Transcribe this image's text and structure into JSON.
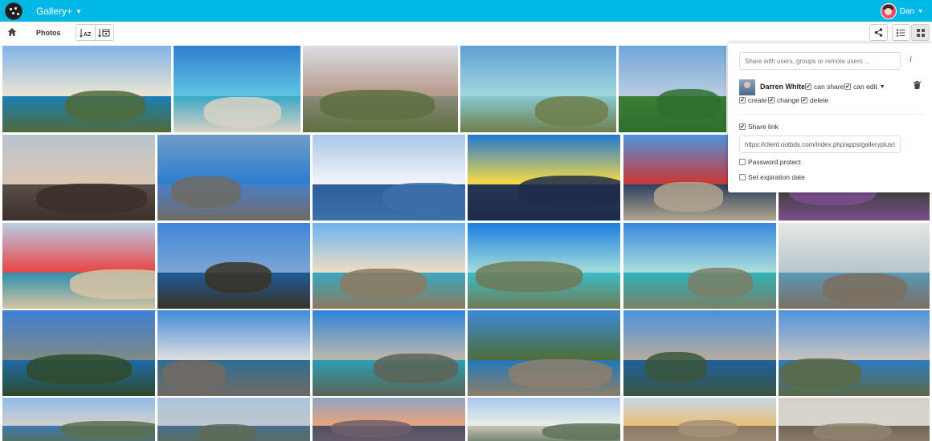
{
  "header": {
    "app_name": "Gallery+",
    "user_name": "Dan",
    "bg_color": "#00b8e6"
  },
  "toolbar": {
    "breadcrumb_label": "Photos",
    "sort_name_icon": "sort-alpha-icon",
    "sort_date_icon": "sort-date-icon",
    "share_icon": "share-icon",
    "list_view_icon": "list-view-icon",
    "grid_view_icon": "grid-view-icon"
  },
  "share_panel": {
    "search_placeholder": "Share with users, groups or remote users ...",
    "sharee": {
      "name": "Darren White",
      "can_share_label": "can share",
      "can_edit_label": "can edit",
      "create_label": "create",
      "change_label": "change",
      "delete_label": "delete",
      "can_share": true,
      "can_edit": true,
      "create": true,
      "change": true,
      "delete": true
    },
    "share_link_label": "Share link",
    "share_link_checked": true,
    "share_link_url": "https://client.ootbds.com/index.php/apps/galleryplus/s/",
    "password_protect_label": "Password protect",
    "password_protect_checked": false,
    "expiration_label": "Set expiration date",
    "expiration_checked": false
  },
  "gallery": {
    "photos": [
      {
        "sky": "#7fb3e8",
        "land": "#4f6b3a",
        "sea": "#1b7fb6",
        "accent": "#e9e3d6"
      },
      {
        "sky": "#2f7fd0",
        "land": "#d8d2c4",
        "sea": "#3aa8c6",
        "accent": "#5cc2e0"
      },
      {
        "sky": "#dcdde5",
        "land": "#5d6f3e",
        "sea": "#8a8a7a",
        "accent": "#b79d8c"
      },
      {
        "sky": "#5f9fd6",
        "land": "#6e7f4a",
        "sea": "#88c9d2",
        "accent": "#9ed5dc"
      },
      {
        "sky": "#6fa6db",
        "land": "#2f6e2e",
        "sea": "#3b7d35",
        "accent": "#b6cbe0"
      },
      {
        "sky": "#b8c4cf",
        "land": "#3a2f2a",
        "sea": "#5a4f48",
        "accent": "#d9c7b3"
      },
      {
        "sky": "#6e9cc7",
        "land": "#6f6b63",
        "sea": "#4a7fc6",
        "accent": "#2f7fcf"
      },
      {
        "sky": "#a8c8e8",
        "land": "#3d6fa8",
        "sea": "#2c5f9a",
        "accent": "#f0f4f8"
      },
      {
        "sky": "#1f78d1",
        "land": "#1e2c4a",
        "sea": "#253654",
        "accent": "#f2d84a"
      },
      {
        "sky": "#4d95df",
        "land": "#b2a58e",
        "sea": "#2b4060",
        "accent": "#c63a3a"
      },
      {
        "sky": "#a07a6b",
        "land": "#7c4e8e",
        "sea": "#2f3d2a",
        "accent": "#c9b0d8"
      },
      {
        "sky": "#b8cfe6",
        "land": "#d7c4a2",
        "sea": "#2d8fb0",
        "accent": "#e64a4a"
      },
      {
        "sky": "#3f86d8",
        "land": "#3a3325",
        "sea": "#1e5a98",
        "accent": "#7ba4d4"
      },
      {
        "sky": "#6cb4f0",
        "land": "#8c7a5e",
        "sea": "#3aa7c4",
        "accent": "#e8dcc6"
      },
      {
        "sky": "#1c7ee0",
        "land": "#6f7a55",
        "sea": "#3bbdc7",
        "accent": "#9fd9da"
      },
      {
        "sky": "#3a88dd",
        "land": "#7a7f66",
        "sea": "#2fb3b9",
        "accent": "#a6dadb"
      },
      {
        "sky": "#e6e7e2",
        "land": "#7b6f5f",
        "sea": "#5a98b8",
        "accent": "#b9c8cf"
      },
      {
        "sky": "#3d7fd6",
        "land": "#2f4a2a",
        "sea": "#1e6aa7",
        "accent": "#7c8a88"
      },
      {
        "sky": "#3f8ad8",
        "land": "#726a63",
        "sea": "#2c6f94",
        "accent": "#d8dbe0"
      },
      {
        "sky": "#2f84d8",
        "land": "#5d6353",
        "sea": "#2b9db4",
        "accent": "#b9b7ad"
      },
      {
        "sky": "#3b89d9",
        "land": "#8d7f6a",
        "sea": "#2178b8",
        "accent": "#4e6f3f"
      },
      {
        "sky": "#4a92db",
        "land": "#39563a",
        "sea": "#1e5f9e",
        "accent": "#b3aaa0"
      },
      {
        "sky": "#4f93dc",
        "land": "#5c6a44",
        "sea": "#2a7bc4",
        "accent": "#c4c2c0"
      },
      {
        "sky": "#8fbde8",
        "land": "#5b6e4b",
        "sea": "#3b79b4",
        "accent": "#cfcfcf"
      },
      {
        "sky": "#a9c4dd",
        "land": "#5f6b56",
        "sea": "#456f8f",
        "accent": "#c0c8cf"
      },
      {
        "sky": "#8ea5c6",
        "land": "#6d5f6b",
        "sea": "#4c4f62",
        "accent": "#e6a47a"
      },
      {
        "sky": "#a6c8ee",
        "land": "#5d7358",
        "sea": "#c8c4bb",
        "accent": "#e8ece8"
      },
      {
        "sky": "#c9d9ea",
        "land": "#a38f77",
        "sea": "#8a7864",
        "accent": "#e8c07a"
      },
      {
        "sky": "#d6d1c8",
        "land": "#8e846f",
        "sea": "#6f6553",
        "accent": "#d8d3cb"
      },
      {
        "sky": "#cfcac0",
        "land": "#7e7468",
        "sea": "#8c8176",
        "accent": "#b1a89b"
      }
    ]
  }
}
